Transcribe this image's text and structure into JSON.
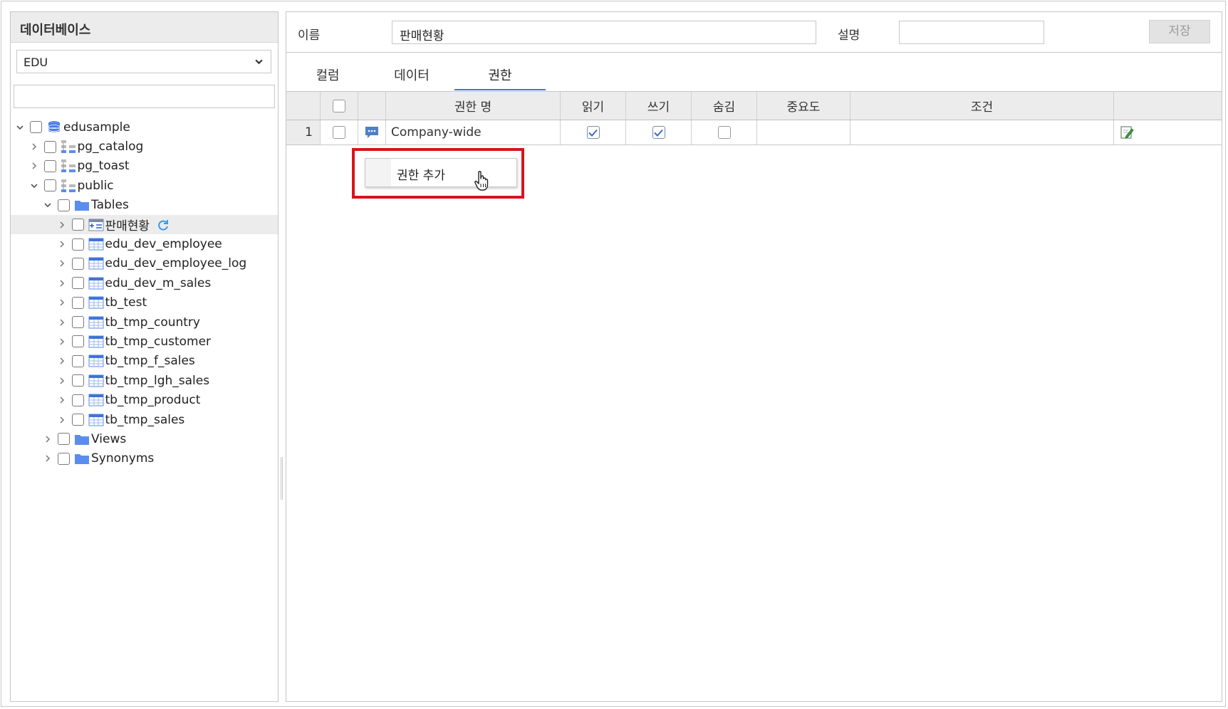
{
  "left_panel": {
    "title": "데이터베이스",
    "db_select": {
      "value": "EDU"
    },
    "search": {
      "value": ""
    },
    "tree": [
      {
        "label": "edusample",
        "icon": "database-icon",
        "level": 0,
        "expanded": true
      },
      {
        "label": "pg_catalog",
        "icon": "schema-icon",
        "level": 1,
        "expanded": false
      },
      {
        "label": "pg_toast",
        "icon": "schema-icon",
        "level": 1,
        "expanded": false
      },
      {
        "label": "public",
        "icon": "schema-icon",
        "level": 1,
        "expanded": true
      },
      {
        "label": "Tables",
        "icon": "folder-icon",
        "level": 2,
        "expanded": true
      },
      {
        "label": "판매현황",
        "icon": "view-table-icon",
        "level": 3,
        "expanded": false,
        "selected": true,
        "refresh": true
      },
      {
        "label": "edu_dev_employee",
        "icon": "table-icon",
        "level": 3,
        "expanded": false
      },
      {
        "label": "edu_dev_employee_log",
        "icon": "table-icon",
        "level": 3,
        "expanded": false
      },
      {
        "label": "edu_dev_m_sales",
        "icon": "table-icon",
        "level": 3,
        "expanded": false
      },
      {
        "label": "tb_test",
        "icon": "table-icon",
        "level": 3,
        "expanded": false
      },
      {
        "label": "tb_tmp_country",
        "icon": "table-icon",
        "level": 3,
        "expanded": false
      },
      {
        "label": "tb_tmp_customer",
        "icon": "table-icon",
        "level": 3,
        "expanded": false
      },
      {
        "label": "tb_tmp_f_sales",
        "icon": "table-icon",
        "level": 3,
        "expanded": false
      },
      {
        "label": "tb_tmp_lgh_sales",
        "icon": "table-icon",
        "level": 3,
        "expanded": false
      },
      {
        "label": "tb_tmp_product",
        "icon": "table-icon",
        "level": 3,
        "expanded": false
      },
      {
        "label": "tb_tmp_sales",
        "icon": "table-icon",
        "level": 3,
        "expanded": false
      },
      {
        "label": "Views",
        "icon": "folder-icon",
        "level": 2,
        "expanded": false
      },
      {
        "label": "Synonyms",
        "icon": "folder-icon",
        "level": 2,
        "expanded": false
      }
    ]
  },
  "form": {
    "name_label": "이름",
    "name_value": "판매현황",
    "desc_label": "설명",
    "desc_value": "",
    "save_label": "저장"
  },
  "tabs": [
    {
      "label": "컬럼",
      "active": false
    },
    {
      "label": "데이터",
      "active": false
    },
    {
      "label": "권한",
      "active": true
    }
  ],
  "grid": {
    "headers": [
      "권한 명",
      "읽기",
      "쓰기",
      "숨김",
      "중요도",
      "조건"
    ],
    "rows": [
      {
        "num": "1",
        "name": "Company-wide",
        "read": true,
        "write": true,
        "hidden": false,
        "priority": "",
        "condition": ""
      }
    ]
  },
  "context_menu": {
    "items": [
      "권한 추가"
    ]
  },
  "colors": {
    "accent": "#3e74d6",
    "highlight": "#d7141c",
    "folder": "#5b8def",
    "header_bg": "#ececec"
  }
}
